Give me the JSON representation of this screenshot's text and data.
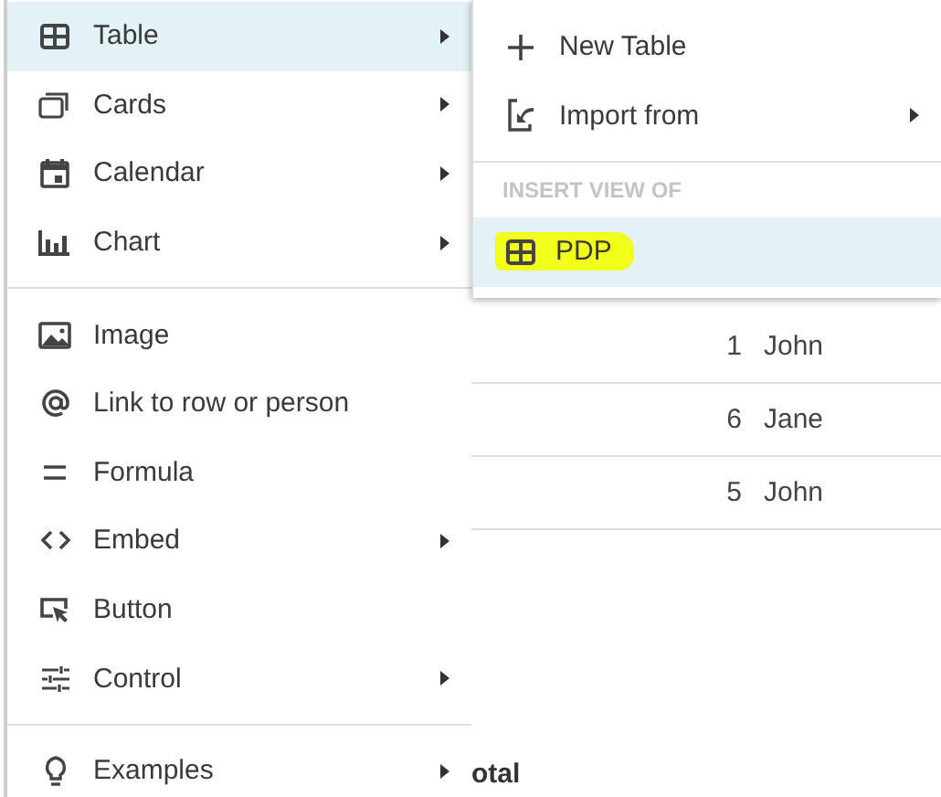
{
  "main_menu": {
    "groups": [
      [
        {
          "label": "Table",
          "has_submenu": true,
          "selected": true
        },
        {
          "label": "Cards",
          "has_submenu": true,
          "selected": false
        },
        {
          "label": "Calendar",
          "has_submenu": true,
          "selected": false
        },
        {
          "label": "Chart",
          "has_submenu": true,
          "selected": false
        }
      ],
      [
        {
          "label": "Image",
          "has_submenu": false,
          "selected": false
        },
        {
          "label": "Link to row or person",
          "has_submenu": false,
          "selected": false
        },
        {
          "label": "Formula",
          "has_submenu": false,
          "selected": false
        },
        {
          "label": "Embed",
          "has_submenu": true,
          "selected": false
        },
        {
          "label": "Button",
          "has_submenu": false,
          "selected": false
        },
        {
          "label": "Control",
          "has_submenu": true,
          "selected": false
        }
      ],
      [
        {
          "label": "Examples",
          "has_submenu": true,
          "selected": false
        }
      ]
    ]
  },
  "submenu": {
    "items": [
      {
        "label": "New Table",
        "has_submenu": false,
        "selected": false
      },
      {
        "label": "Import from",
        "has_submenu": true,
        "selected": false
      }
    ],
    "section_header": "INSERT VIEW OF",
    "views": [
      {
        "label": "PDP",
        "selected": true,
        "marker_highlight": true
      }
    ]
  },
  "background_table": {
    "rows": [
      {
        "column_1": "1",
        "column_2": "John"
      },
      {
        "column_1": "6",
        "column_2": "Jane"
      },
      {
        "column_1": "5",
        "column_2": "John"
      }
    ],
    "footer_label": "otal"
  }
}
